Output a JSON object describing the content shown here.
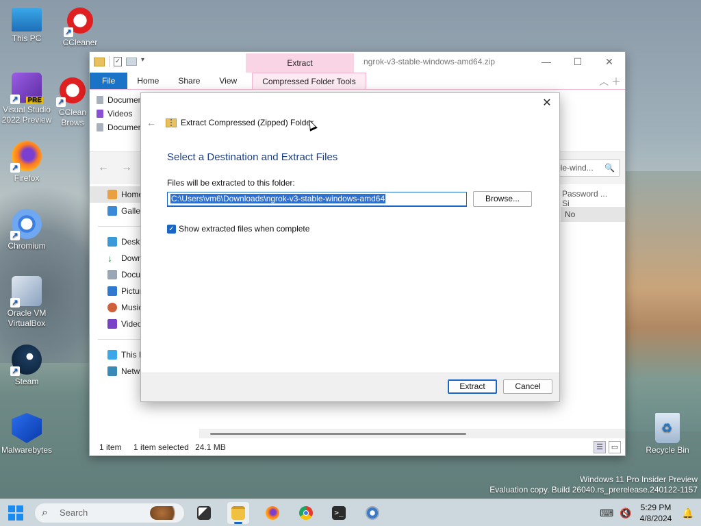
{
  "desktop": {
    "icons": [
      {
        "label": "This PC"
      },
      {
        "label": "CCleaner"
      },
      {
        "label": "Visual Studio 2022 Preview",
        "badge": "PRE"
      },
      {
        "label": "CCleaner Browser"
      },
      {
        "label": "Firefox"
      },
      {
        "label": "Chromium"
      },
      {
        "label": "Oracle VM VirtualBox"
      },
      {
        "label": "Steam"
      },
      {
        "label": "Malwarebytes"
      },
      {
        "label": "Recycle Bin"
      }
    ],
    "vs_line1": "Visual Studio",
    "vs_line2": "2022 Preview",
    "ccb_line1": "CClean",
    "ccb_line2": "Brows",
    "vbox_line1": "Oracle VM",
    "vbox_line2": "VirtualBox"
  },
  "explorer": {
    "window_title": "ngrok-v3-stable-windows-amd64.zip",
    "context_tab": "Extract",
    "ribbon_tabs": [
      "File",
      "Home",
      "Share",
      "View",
      "Compressed Folder Tools"
    ],
    "recent": [
      "Documen",
      "Videos",
      "Documen"
    ],
    "search_value": "ble-wind...",
    "nav": [
      "Home",
      "Galler",
      "Deskt",
      "Down",
      "Docu",
      "Pictur",
      "Music",
      "Video",
      "This P",
      "Netw"
    ],
    "columns": [
      "Password ...",
      "Si"
    ],
    "row_value": "No",
    "status": {
      "items": "1 item",
      "selected": "1 item selected",
      "size": "24.1 MB"
    }
  },
  "dialog": {
    "heading": "Extract Compressed (Zipped) Folder",
    "title": "Select a Destination and Extract Files",
    "label": "Files will be extracted to this folder:",
    "path": "C:\\Users\\vm6\\Downloads\\ngrok-v3-stable-windows-amd64",
    "browse": "Browse...",
    "checkbox_label": "Show extracted files when complete",
    "checkbox_checked": true,
    "extract": "Extract",
    "cancel": "Cancel"
  },
  "watermark": {
    "line1": "Windows 11 Pro Insider Preview",
    "line2": "Evaluation copy. Build 26040.rs_prerelease.240122-1157"
  },
  "taskbar": {
    "search_placeholder": "Search",
    "time": "5:29 PM",
    "date": "4/8/2024"
  },
  "colors": {
    "accent": "#1a66c5",
    "context_tab": "#f9d4e4",
    "dialog_title": "#1b3f8a"
  }
}
